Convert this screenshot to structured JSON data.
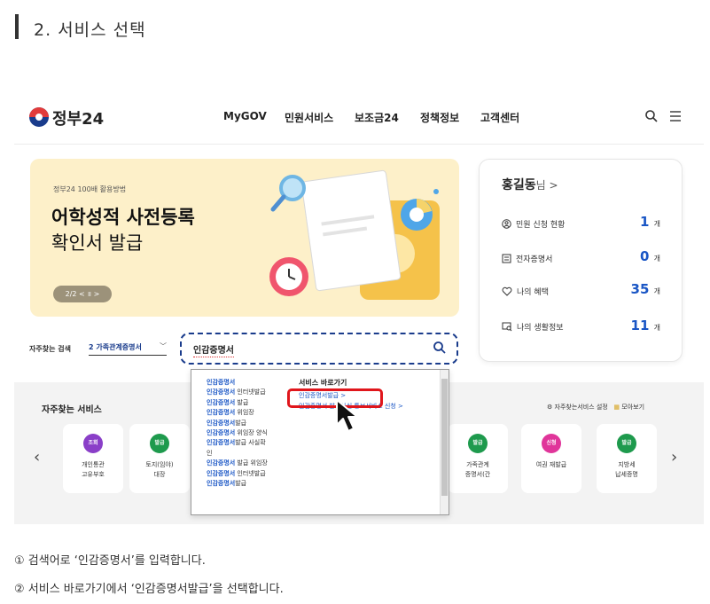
{
  "section": {
    "title": "2. 서비스 선택"
  },
  "header": {
    "logo": "정부24",
    "nav": [
      "MyGOV",
      "민원서비스",
      "보조금24",
      "정책정보",
      "고객센터"
    ],
    "icons": [
      "search-icon",
      "menu-icon"
    ]
  },
  "banner": {
    "small": "정부24 100배 활용방법",
    "title_line1": "어학성적 사전등록",
    "title_line2": "확인서 발급",
    "pager": "2/2 < ॥ >",
    "bg_color": "#fdf0c9"
  },
  "user_card": {
    "name": "홍길동",
    "name_suffix": "님 >",
    "rows": [
      {
        "label": "민원 신청 현황",
        "count": "1",
        "unit": "개",
        "icon": "person-circle-icon"
      },
      {
        "label": "전자증명서",
        "count": "0",
        "unit": "개",
        "icon": "document-icon"
      },
      {
        "label": "나의 혜택",
        "count": "35",
        "unit": "개",
        "icon": "heart-icon"
      },
      {
        "label": "나의 생활정보",
        "count": "11",
        "unit": "개",
        "icon": "window-search-icon"
      }
    ]
  },
  "search": {
    "fav_label": "자주찾는 검색",
    "fav_selected": "2 가족관계증명서",
    "value": "인감증명서"
  },
  "dropdown": {
    "suggestions": [
      {
        "bold": "인감증명서",
        "rest": ""
      },
      {
        "bold": "인감증명서",
        "rest": " 인터넷발급"
      },
      {
        "bold": "인감증명서",
        "rest": " 발급"
      },
      {
        "bold": "인감증명서",
        "rest": " 위임장"
      },
      {
        "bold": "인감증명서",
        "rest": "발급"
      },
      {
        "bold": "인감증명서",
        "rest": " 위임장 양식"
      },
      {
        "bold": "인감증명서",
        "rest": "발급 사실확"
      },
      {
        "bold": "",
        "rest": "인"
      },
      {
        "bold": "인감증명서",
        "rest": " 발급 위임장"
      },
      {
        "bold": "인감증명서",
        "rest": " 인터넷발급"
      },
      {
        "bold": "인감증명서",
        "rest": "발급"
      }
    ],
    "shortcut_header": "서비스 바로가기",
    "shortcuts": [
      "인감증명서발급 >",
      "인감증명서 발급사실 통보서비스 신청 >"
    ]
  },
  "frequent": {
    "title": "자주찾는 서비스",
    "settings": "자주찾는서비스 설정",
    "view_all": "모아보기",
    "tiles": [
      {
        "badge": "조회",
        "label": "개인통관\n고유부호",
        "color": "#8a3fc8"
      },
      {
        "badge": "발급",
        "label": "토지(임야)\n대장",
        "color": "#1e9a4d"
      },
      {
        "badge": "발급",
        "label": "가족관계\n증명서(간",
        "color": "#1e9a4d"
      },
      {
        "badge": "신청",
        "label": "여권 재발급",
        "color": "#e0359a"
      },
      {
        "badge": "발급",
        "label": "지방세\n납세증명",
        "color": "#1e9a4d"
      }
    ]
  },
  "instructions": [
    "① 검색어로 ‘인감증명서’를 입력합니다.",
    "② 서비스 바로가기에서 ‘인감증명서발급’을 선택합니다."
  ],
  "colors": {
    "brand": "#1a3c8c",
    "highlight": "#e0161c",
    "link": "#1a56c5"
  }
}
